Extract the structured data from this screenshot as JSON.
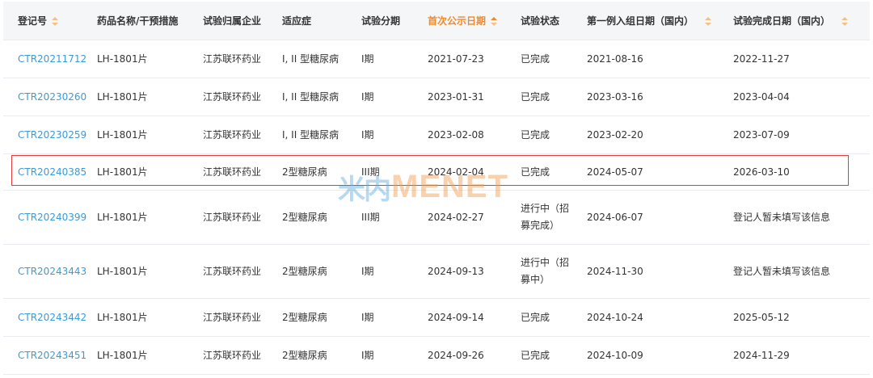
{
  "table": {
    "columns": [
      {
        "label": "登记号",
        "sortable": true,
        "active": false
      },
      {
        "label": "药品名称/干预措施",
        "sortable": false,
        "active": false
      },
      {
        "label": "试验归属企业",
        "sortable": false,
        "active": false
      },
      {
        "label": "适应症",
        "sortable": false,
        "active": false
      },
      {
        "label": "试验分期",
        "sortable": false,
        "active": false
      },
      {
        "label": "首次公示日期",
        "sortable": true,
        "active": true
      },
      {
        "label": "试验状态",
        "sortable": false,
        "active": false
      },
      {
        "label": "第一例入组日期（国内）",
        "sortable": true,
        "active": false
      },
      {
        "label": "试验完成日期（国内）",
        "sortable": true,
        "active": false
      }
    ],
    "rows": [
      {
        "reg": "CTR20211712",
        "drug": "LH-1801片",
        "company": "江苏联环药业",
        "indication": "I, II 型糖尿病",
        "phase": "I期",
        "publish": "2021-07-23",
        "status": "已完成",
        "first": "2021-08-16",
        "complete": "2022-11-27"
      },
      {
        "reg": "CTR20230260",
        "drug": "LH-1801片",
        "company": "江苏联环药业",
        "indication": "I, II 型糖尿病",
        "phase": "I期",
        "publish": "2023-01-31",
        "status": "已完成",
        "first": "2023-03-16",
        "complete": "2023-04-04"
      },
      {
        "reg": "CTR20230259",
        "drug": "LH-1801片",
        "company": "江苏联环药业",
        "indication": "I, II 型糖尿病",
        "phase": "I期",
        "publish": "2023-02-08",
        "status": "已完成",
        "first": "2023-02-20",
        "complete": "2023-07-09"
      },
      {
        "reg": "CTR20240385",
        "drug": "LH-1801片",
        "company": "江苏联环药业",
        "indication": "2型糖尿病",
        "phase": "III期",
        "publish": "2024-02-04",
        "status": "已完成",
        "first": "2024-05-07",
        "complete": "2026-03-10"
      },
      {
        "reg": "CTR20240399",
        "drug": "LH-1801片",
        "company": "江苏联环药业",
        "indication": "2型糖尿病",
        "phase": "III期",
        "publish": "2024-02-27",
        "status": "进行中（招募完成）",
        "first": "2024-06-07",
        "complete": "登记人暂未填写该信息"
      },
      {
        "reg": "CTR20243443",
        "drug": "LH-1801片",
        "company": "江苏联环药业",
        "indication": "2型糖尿病",
        "phase": "I期",
        "publish": "2024-09-13",
        "status": "进行中（招募中）",
        "first": "2024-11-30",
        "complete": "登记人暂未填写该信息"
      },
      {
        "reg": "CTR20243442",
        "drug": "LH-1801片",
        "company": "江苏联环药业",
        "indication": "2型糖尿病",
        "phase": "I期",
        "publish": "2024-09-14",
        "status": "已完成",
        "first": "2024-10-24",
        "complete": "2025-05-12"
      },
      {
        "reg": "CTR20243451",
        "drug": "LH-1801片",
        "company": "江苏联环药业",
        "indication": "2型糖尿病",
        "phase": "I期",
        "publish": "2024-09-26",
        "status": "已完成",
        "first": "2024-10-09",
        "complete": "2024-11-29"
      }
    ]
  },
  "highlight": {
    "row_reg": "CTR20240385",
    "color": "#e23b3b"
  },
  "watermark": {
    "cn": "米内",
    "en": "MENET"
  },
  "colors": {
    "link": "#3a9bd9",
    "active_header": "#f08a2b",
    "header_bg": "#f5f6f8",
    "border": "#e8ebf0"
  }
}
